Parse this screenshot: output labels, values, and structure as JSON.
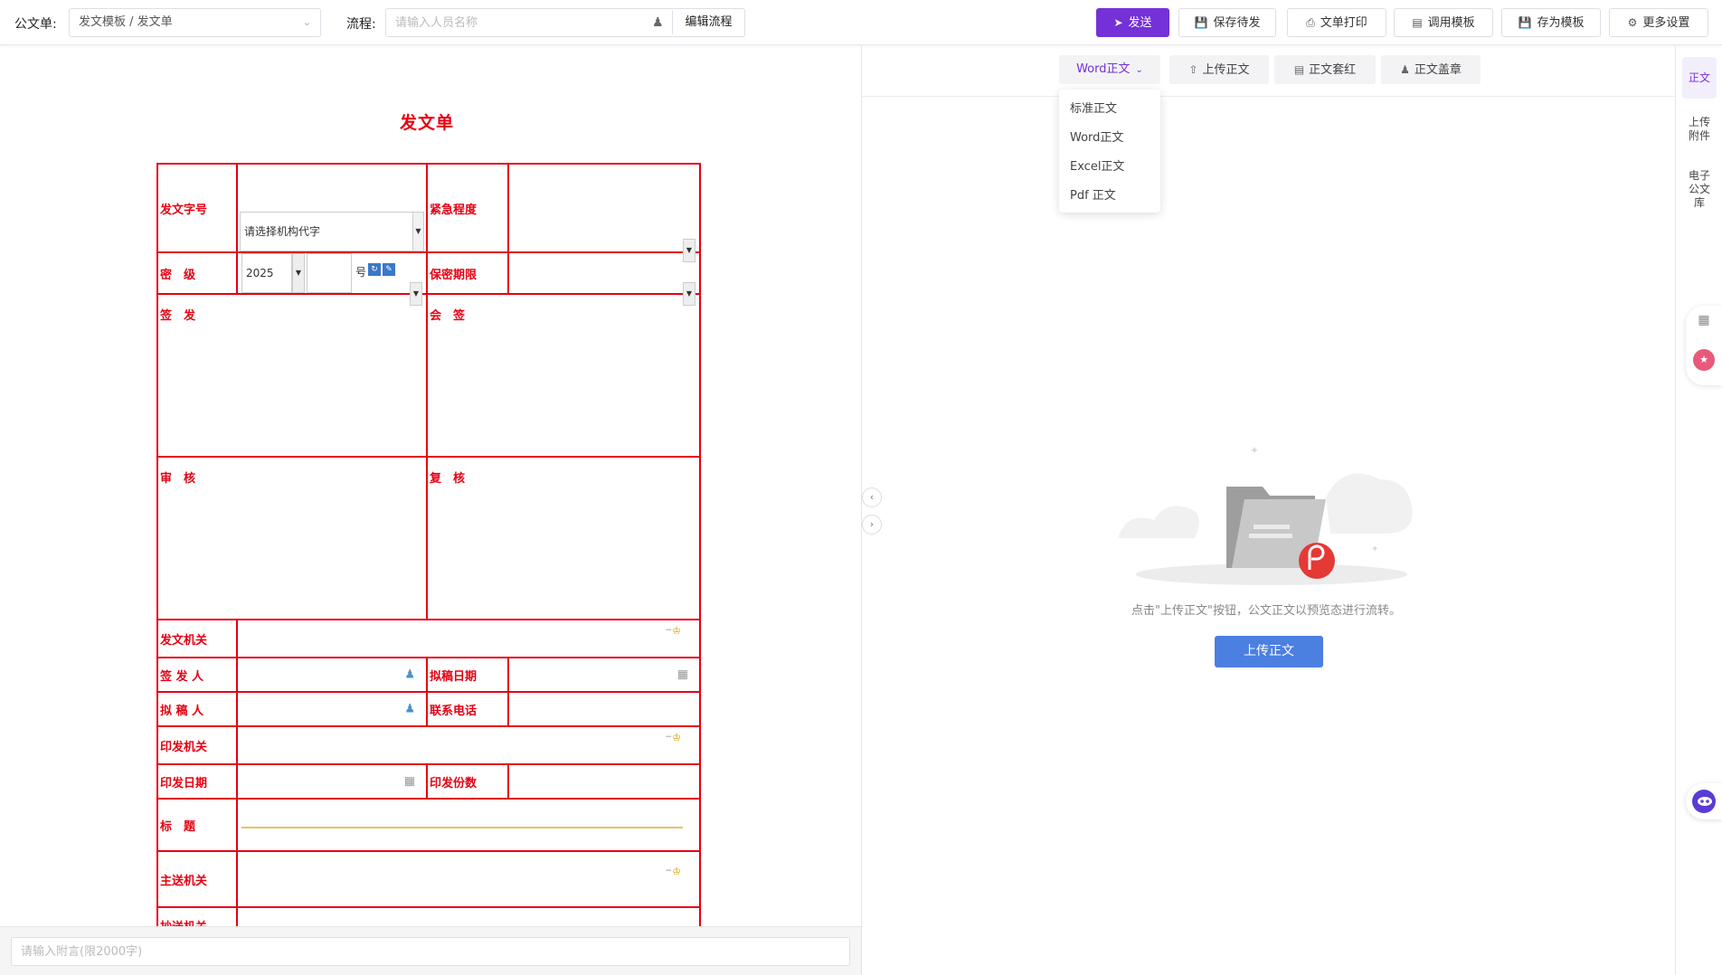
{
  "toolbar": {
    "doc_label": "公文单:",
    "doc_template": "发文模板 / 发文单",
    "flow_label": "流程:",
    "flow_placeholder": "请输入人员名称",
    "edit_flow": "编辑流程",
    "send": "发送",
    "save_pending": "保存待发",
    "print": "文单打印",
    "use_template": "调用模板",
    "save_template": "存为模板",
    "more_settings": "更多设置"
  },
  "form": {
    "title": "发文单",
    "labels": {
      "doc_number": "发文字号",
      "urgency": "紧急程度",
      "secret_level": "密　级",
      "secret_period": "保密期限",
      "sign_issue": "签　发",
      "countersign": "会　签",
      "review": "审　核",
      "recheck": "复　核",
      "issuing_org": "发文机关",
      "signer": "签 发 人",
      "draft_date": "拟稿日期",
      "drafter": "拟 稿 人",
      "phone": "联系电话",
      "print_org": "印发机关",
      "print_date": "印发日期",
      "print_copies": "印发份数",
      "subject": "标　题",
      "main_recipient": "主送机关",
      "cc_org": "抄送机关"
    },
    "org_code_placeholder": "请选择机构代字",
    "year": "2025",
    "number_suffix": "号",
    "attachment_placeholder": "请输入附言(限2000字)"
  },
  "right": {
    "tabs": {
      "word": "Word正文",
      "upload": "上传正文",
      "redhead": "正文套红",
      "seal": "正文盖章"
    },
    "dropdown": [
      "标准正文",
      "Word正文",
      "Excel正文",
      "Pdf 正文"
    ],
    "empty_text": "点击\"上传正文\"按钮，公文正文以预览态进行流转。",
    "upload_button": "上传正文"
  },
  "rail": {
    "body": "正文",
    "attachment": "上传\n附件",
    "library": "电子\n公文\n库"
  },
  "colors": {
    "accent": "#7431d8",
    "form_red": "#e60012",
    "upload_blue": "#4b7fe0",
    "title_fill": "#ffdb8a"
  }
}
